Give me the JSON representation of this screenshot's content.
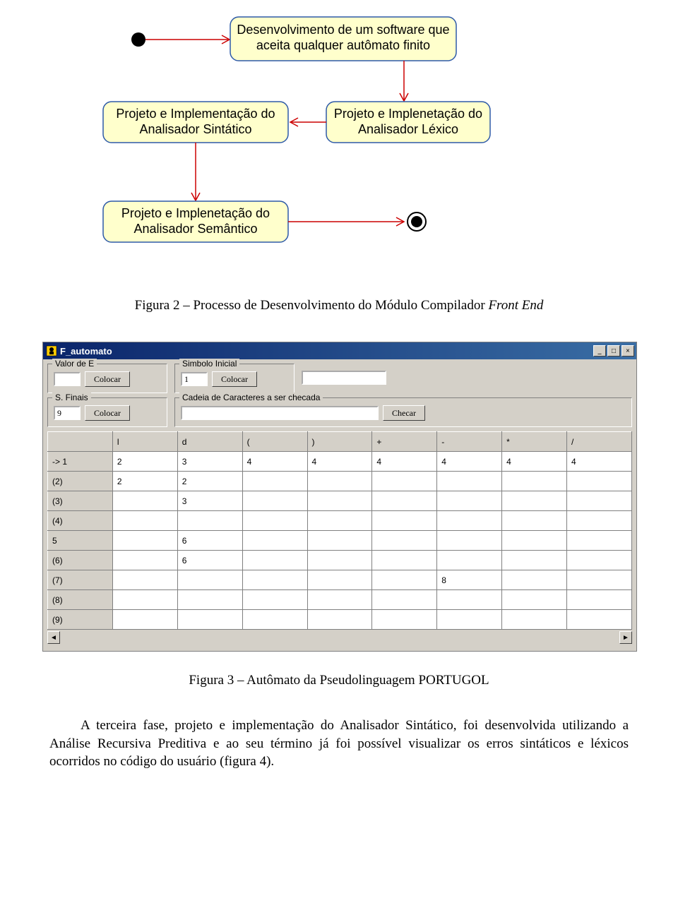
{
  "uml": {
    "box1": {
      "line1": "Desenvolvimento de um software que",
      "line2": "aceita qualquer autômato finito"
    },
    "box2": {
      "line1": "Projeto e Implementação do",
      "line2": "Analisador Sintático"
    },
    "box3": {
      "line1": "Projeto e Implenetação do",
      "line2": "Analisador Léxico"
    },
    "box4": {
      "line1": "Projeto e Implenetação do",
      "line2": "Analisador Semântico"
    }
  },
  "captions": {
    "fig2_label": "Figura 2 – Processo de Desenvolvimento do Módulo Compilador ",
    "fig2_italic": "Front End",
    "fig3": "Figura 3 – Autômato da Pseudolinguagem PORTUGOL"
  },
  "window": {
    "title": "F_automato",
    "groups": {
      "valorE": {
        "legend": "Valor de E",
        "value": "",
        "button": "Colocar"
      },
      "simbolo": {
        "legend": "Simbolo Inicial",
        "value": "1",
        "button": "Colocar"
      },
      "sfinais": {
        "legend": "S. Finais",
        "value": "9",
        "button": "Colocar"
      },
      "cadeia": {
        "legend": "Cadeia de Caracteres a ser checada",
        "value": "",
        "button": "Checar"
      }
    },
    "lone_input": ""
  },
  "table": {
    "headers": [
      "",
      "l",
      "d",
      "(",
      ")",
      "+",
      "-",
      "*",
      "/"
    ],
    "rows": [
      {
        "head": "-> 1",
        "cells": [
          "2",
          "3",
          "4",
          "4",
          "4",
          "4",
          "4",
          "4"
        ]
      },
      {
        "head": "(2)",
        "cells": [
          "2",
          "2",
          "",
          "",
          "",
          "",
          "",
          ""
        ]
      },
      {
        "head": "(3)",
        "cells": [
          "",
          "3",
          "",
          "",
          "",
          "",
          "",
          ""
        ]
      },
      {
        "head": "(4)",
        "cells": [
          "",
          "",
          "",
          "",
          "",
          "",
          "",
          ""
        ]
      },
      {
        "head": "5",
        "cells": [
          "",
          "6",
          "",
          "",
          "",
          "",
          "",
          ""
        ]
      },
      {
        "head": "(6)",
        "cells": [
          "",
          "6",
          "",
          "",
          "",
          "",
          "",
          ""
        ]
      },
      {
        "head": "(7)",
        "cells": [
          "",
          "",
          "",
          "",
          "",
          "8",
          "",
          ""
        ]
      },
      {
        "head": "(8)",
        "cells": [
          "",
          "",
          "",
          "",
          "",
          "",
          "",
          ""
        ]
      },
      {
        "head": "(9)",
        "cells": [
          "",
          "",
          "",
          "",
          "",
          "",
          "",
          ""
        ]
      }
    ]
  },
  "paragraph": "A terceira fase, projeto e implementação do Analisador Sintático, foi desenvolvida utilizando a Análise Recursiva Preditiva e ao seu término já foi possível visualizar os erros sintáticos e léxicos ocorridos no código do usuário (figura 4)."
}
